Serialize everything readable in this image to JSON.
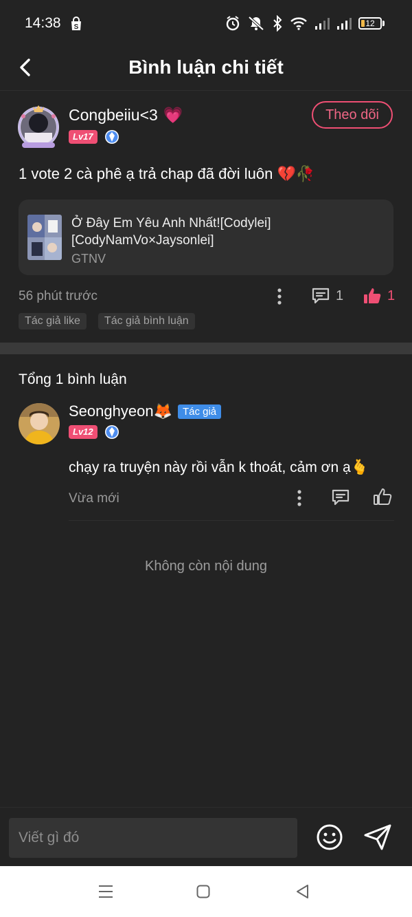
{
  "status_bar": {
    "time": "14:38",
    "battery": "12",
    "icons": [
      "shop-bag-icon",
      "alarm-icon",
      "mute-icon",
      "bluetooth-icon",
      "wifi-icon",
      "signal-icon",
      "signal-icon",
      "battery-icon"
    ]
  },
  "header": {
    "title": "Bình luận chi tiết"
  },
  "post": {
    "username": "Congbeiiu<3",
    "username_emoji": "💗",
    "level": "Lv17",
    "follow_label": "Theo dõi",
    "text": "1 vote 2 cà phê ạ trả chap đã đời luôn 💔🥀",
    "book": {
      "title": "Ở Đây Em Yêu Anh Nhất![Codylei][CodyNamVo×Jaysonlei]",
      "author": "GTNV"
    },
    "time": "56 phút trước",
    "comment_count": "1",
    "like_count": "1",
    "tags": [
      "Tác giả like",
      "Tác giả bình luận"
    ]
  },
  "comments": {
    "total_label": "Tổng 1 bình luận",
    "items": [
      {
        "username": "Seonghyeon🦊",
        "author_tag": "Tác giả",
        "level": "Lv12",
        "text": "chạy ra truyện này rồi vẫn k thoát, cảm ơn ạ🫰",
        "time": "Vừa mới"
      }
    ],
    "end_label": "Không còn nội dung"
  },
  "input": {
    "placeholder": "Viết gì đó"
  },
  "colors": {
    "background": "#232323",
    "accent": "#ef4f74",
    "author_tag": "#3f8de8",
    "muted_text": "#9a9a9a"
  }
}
